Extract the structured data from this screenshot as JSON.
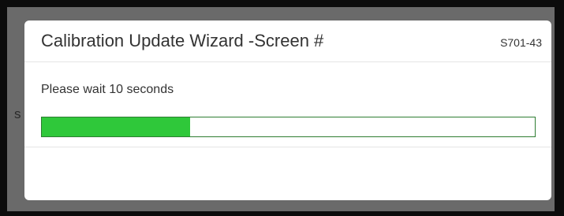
{
  "background": {
    "partial_text": "s"
  },
  "dialog": {
    "title": "Calibration Update Wizard -Screen #",
    "screen_code": "S701-43",
    "message": "Please wait 10 seconds",
    "progress": {
      "value_fraction": 0.3,
      "fill_color": "#2fc83a",
      "border_color": "#2e7d32"
    }
  }
}
